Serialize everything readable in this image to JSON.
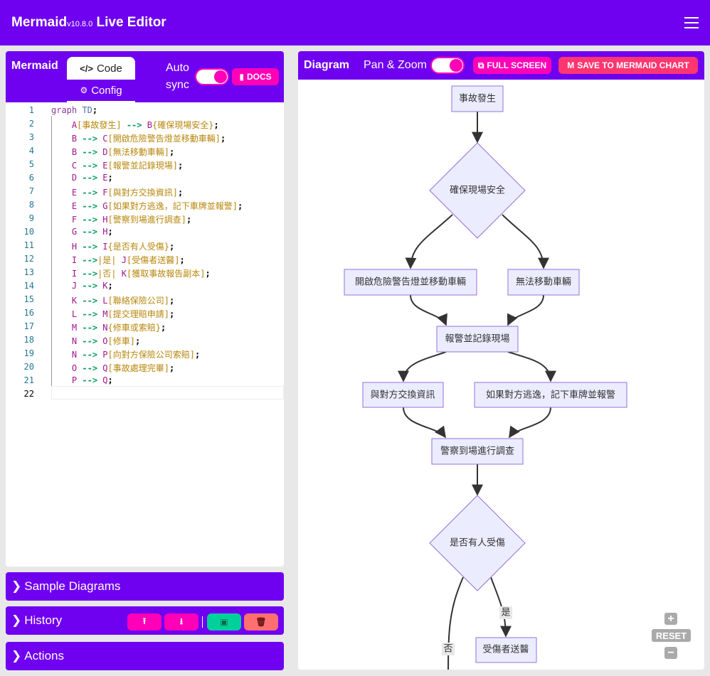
{
  "header": {
    "brand": "Mermaid",
    "version": "v10.8.0",
    "suffix": " Live Editor",
    "menu_icon": "hamburger-icon"
  },
  "editor_panel": {
    "title": "Mermaid",
    "tabs": [
      {
        "label": "Code",
        "icon": "code-icon"
      },
      {
        "label": "Config",
        "icon": "gears-icon"
      }
    ],
    "auto_sync_line1": "Auto",
    "auto_sync_line2": "sync",
    "auto_sync_on": true,
    "docs_label": "DOCS"
  },
  "code_lines": [
    [
      [
        "kw",
        "graph"
      ],
      [
        "pl",
        " "
      ],
      [
        "td",
        "TD"
      ],
      [
        "pu",
        ";"
      ]
    ],
    [
      [
        "pl",
        "    "
      ],
      [
        "id",
        "A"
      ],
      [
        "tx",
        "[事故發生]"
      ],
      [
        "pl",
        " "
      ],
      [
        "ar",
        "-->"
      ],
      [
        "pl",
        " "
      ],
      [
        "id",
        "B"
      ],
      [
        "tx",
        "{確保現場安全}"
      ],
      [
        "pu",
        ";"
      ]
    ],
    [
      [
        "pl",
        "    "
      ],
      [
        "id",
        "B"
      ],
      [
        "pl",
        " "
      ],
      [
        "ar",
        "-->"
      ],
      [
        "pl",
        " "
      ],
      [
        "id",
        "C"
      ],
      [
        "tx",
        "[開啟危險警告燈並移動車輛]"
      ],
      [
        "pu",
        ";"
      ]
    ],
    [
      [
        "pl",
        "    "
      ],
      [
        "id",
        "B"
      ],
      [
        "pl",
        " "
      ],
      [
        "ar",
        "-->"
      ],
      [
        "pl",
        " "
      ],
      [
        "id",
        "D"
      ],
      [
        "tx",
        "[無法移動車輛]"
      ],
      [
        "pu",
        ";"
      ]
    ],
    [
      [
        "pl",
        "    "
      ],
      [
        "id",
        "C"
      ],
      [
        "pl",
        " "
      ],
      [
        "ar",
        "-->"
      ],
      [
        "pl",
        " "
      ],
      [
        "id",
        "E"
      ],
      [
        "tx",
        "[報警並記錄現場]"
      ],
      [
        "pu",
        ";"
      ]
    ],
    [
      [
        "pl",
        "    "
      ],
      [
        "id",
        "D"
      ],
      [
        "pl",
        " "
      ],
      [
        "ar",
        "-->"
      ],
      [
        "pl",
        " "
      ],
      [
        "id",
        "E"
      ],
      [
        "pu",
        ";"
      ]
    ],
    [
      [
        "pl",
        "    "
      ],
      [
        "id",
        "E"
      ],
      [
        "pl",
        " "
      ],
      [
        "ar",
        "-->"
      ],
      [
        "pl",
        " "
      ],
      [
        "id",
        "F"
      ],
      [
        "tx",
        "[與對方交換資訊]"
      ],
      [
        "pu",
        ";"
      ]
    ],
    [
      [
        "pl",
        "    "
      ],
      [
        "id",
        "E"
      ],
      [
        "pl",
        " "
      ],
      [
        "ar",
        "-->"
      ],
      [
        "pl",
        " "
      ],
      [
        "id",
        "G"
      ],
      [
        "tx",
        "[如果對方逃逸，記下車牌並報警]"
      ],
      [
        "pu",
        ";"
      ]
    ],
    [
      [
        "pl",
        "    "
      ],
      [
        "id",
        "F"
      ],
      [
        "pl",
        " "
      ],
      [
        "ar",
        "-->"
      ],
      [
        "pl",
        " "
      ],
      [
        "id",
        "H"
      ],
      [
        "tx",
        "[警察到場進行調查]"
      ],
      [
        "pu",
        ";"
      ]
    ],
    [
      [
        "pl",
        "    "
      ],
      [
        "id",
        "G"
      ],
      [
        "pl",
        " "
      ],
      [
        "ar",
        "-->"
      ],
      [
        "pl",
        " "
      ],
      [
        "id",
        "H"
      ],
      [
        "pu",
        ";"
      ]
    ],
    [
      [
        "pl",
        "    "
      ],
      [
        "id",
        "H"
      ],
      [
        "pl",
        " "
      ],
      [
        "ar",
        "-->"
      ],
      [
        "pl",
        " "
      ],
      [
        "id",
        "I"
      ],
      [
        "tx",
        "{是否有人受傷}"
      ],
      [
        "pu",
        ";"
      ]
    ],
    [
      [
        "pl",
        "    "
      ],
      [
        "id",
        "I"
      ],
      [
        "pl",
        " "
      ],
      [
        "ar",
        "-->"
      ],
      [
        "tx",
        "|是|"
      ],
      [
        "pl",
        " "
      ],
      [
        "id",
        "J"
      ],
      [
        "tx",
        "[受傷者送醫]"
      ],
      [
        "pu",
        ";"
      ]
    ],
    [
      [
        "pl",
        "    "
      ],
      [
        "id",
        "I"
      ],
      [
        "pl",
        " "
      ],
      [
        "ar",
        "-->"
      ],
      [
        "tx",
        "|否|"
      ],
      [
        "pl",
        " "
      ],
      [
        "id",
        "K"
      ],
      [
        "tx",
        "[獲取事故報告副本]"
      ],
      [
        "pu",
        ";"
      ]
    ],
    [
      [
        "pl",
        "    "
      ],
      [
        "id",
        "J"
      ],
      [
        "pl",
        " "
      ],
      [
        "ar",
        "-->"
      ],
      [
        "pl",
        " "
      ],
      [
        "id",
        "K"
      ],
      [
        "pu",
        ";"
      ]
    ],
    [
      [
        "pl",
        "    "
      ],
      [
        "id",
        "K"
      ],
      [
        "pl",
        " "
      ],
      [
        "ar",
        "-->"
      ],
      [
        "pl",
        " "
      ],
      [
        "id",
        "L"
      ],
      [
        "tx",
        "[聯絡保險公司]"
      ],
      [
        "pu",
        ";"
      ]
    ],
    [
      [
        "pl",
        "    "
      ],
      [
        "id",
        "L"
      ],
      [
        "pl",
        " "
      ],
      [
        "ar",
        "-->"
      ],
      [
        "pl",
        " "
      ],
      [
        "id",
        "M"
      ],
      [
        "tx",
        "[提交理賠申請]"
      ],
      [
        "pu",
        ";"
      ]
    ],
    [
      [
        "pl",
        "    "
      ],
      [
        "id",
        "M"
      ],
      [
        "pl",
        " "
      ],
      [
        "ar",
        "-->"
      ],
      [
        "pl",
        " "
      ],
      [
        "id",
        "N"
      ],
      [
        "tx",
        "{修車或索賠}"
      ],
      [
        "pu",
        ";"
      ]
    ],
    [
      [
        "pl",
        "    "
      ],
      [
        "id",
        "N"
      ],
      [
        "pl",
        " "
      ],
      [
        "ar",
        "-->"
      ],
      [
        "pl",
        " "
      ],
      [
        "id",
        "O"
      ],
      [
        "tx",
        "[修車]"
      ],
      [
        "pu",
        ";"
      ]
    ],
    [
      [
        "pl",
        "    "
      ],
      [
        "id",
        "N"
      ],
      [
        "pl",
        " "
      ],
      [
        "ar",
        "-->"
      ],
      [
        "pl",
        " "
      ],
      [
        "id",
        "P"
      ],
      [
        "tx",
        "[向對方保險公司索賠]"
      ],
      [
        "pu",
        ";"
      ]
    ],
    [
      [
        "pl",
        "    "
      ],
      [
        "id",
        "O"
      ],
      [
        "pl",
        " "
      ],
      [
        "ar",
        "-->"
      ],
      [
        "pl",
        " "
      ],
      [
        "id",
        "Q"
      ],
      [
        "tx",
        "[事故處理完畢]"
      ],
      [
        "pu",
        ";"
      ]
    ],
    [
      [
        "pl",
        "    "
      ],
      [
        "id",
        "P"
      ],
      [
        "pl",
        " "
      ],
      [
        "ar",
        "-->"
      ],
      [
        "pl",
        " "
      ],
      [
        "id",
        "Q"
      ],
      [
        "pu",
        ";"
      ]
    ],
    []
  ],
  "accordions": {
    "sample": "Sample Diagrams",
    "history": "History",
    "actions": "Actions",
    "history_buttons": [
      {
        "icon": "upload-icon",
        "color": "#ff00b8"
      },
      {
        "icon": "download-icon",
        "color": "#ff00b8"
      },
      {
        "icon": "save-icon",
        "color": "#00d19a"
      },
      {
        "icon": "trash-icon",
        "color": "#ff6f6f"
      }
    ]
  },
  "diagram_panel": {
    "title": "Diagram",
    "pan_zoom_label": "Pan & Zoom",
    "pan_zoom_on": true,
    "full_screen_label": "FULL SCREEN",
    "save_chart_label": "SAVE TO MERMAID CHART"
  },
  "diagram": {
    "nodes": {
      "A": "事故發生",
      "B": "確保現場安全",
      "C": "開啟危險警告燈並移動車輛",
      "D": "無法移動車輛",
      "E": "報警並記錄現場",
      "F": "與對方交換資訊",
      "G": "如果對方逃逸，記下車牌並報警",
      "H": "警察到場進行調查",
      "I": "是否有人受傷",
      "J": "受傷者送醫"
    },
    "edge_labels": {
      "yes": "是",
      "no": "否"
    },
    "node_fill": "#ececff",
    "node_stroke": "#9370db"
  },
  "zoom_controls": {
    "reset": "RESET"
  },
  "colors": {
    "primary": "#6f00f0",
    "accent": "#ff00b8",
    "save_chart": "#ff3670"
  }
}
